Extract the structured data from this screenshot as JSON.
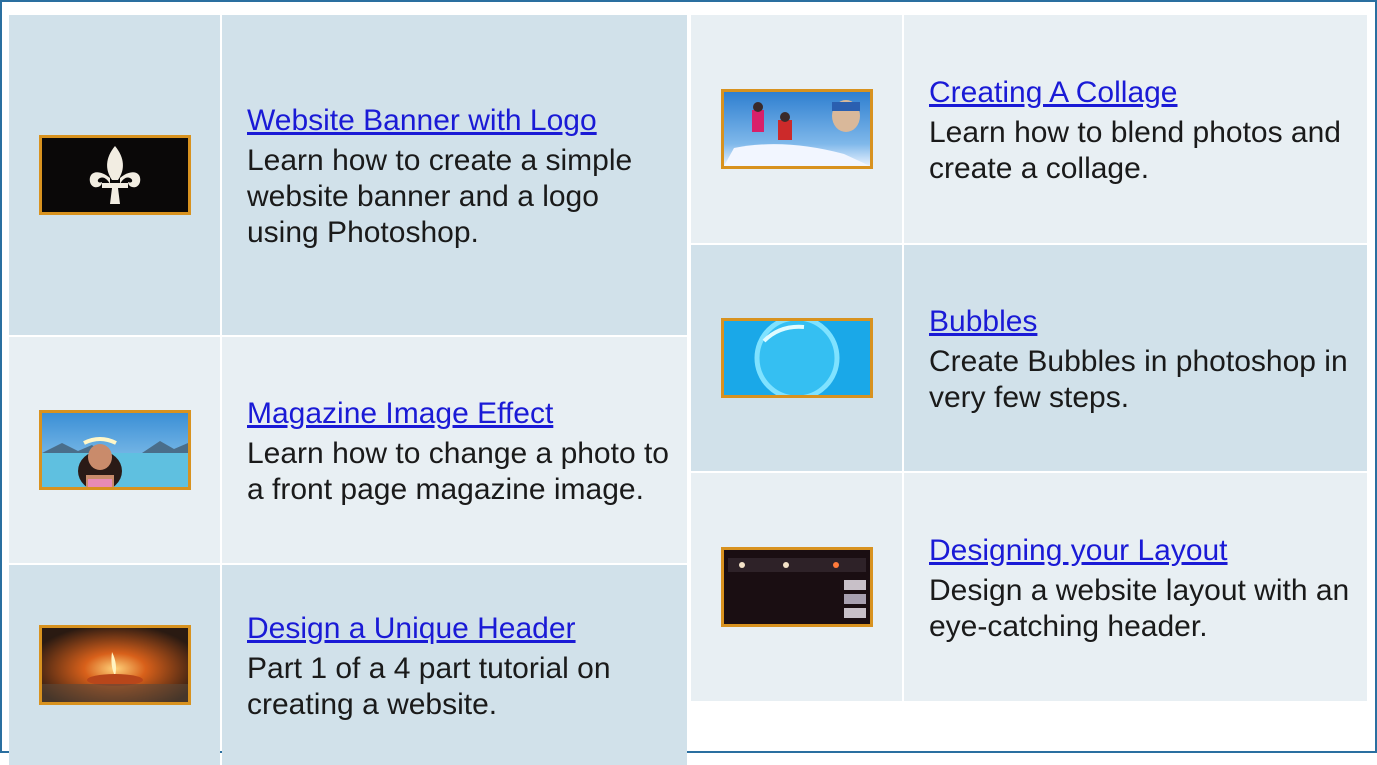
{
  "tutorials_left": [
    {
      "title": "Website Banner with Logo",
      "description": "Learn how to create a simple website banner and a logo using Photoshop.",
      "thumbnail": "fleur-de-lis-thumbnail"
    },
    {
      "title": "Magazine Image Effect",
      "description": "Learn how to change a photo to a front page magazine image.",
      "thumbnail": "beach-photo-thumbnail"
    },
    {
      "title": "Design a Unique Header",
      "description": "Part 1 of a 4 part tutorial on creating a website.",
      "thumbnail": "candle-thumbnail"
    }
  ],
  "tutorials_right": [
    {
      "title": "Creating A Collage",
      "description": "Learn how to blend photos and create a collage.",
      "thumbnail": "skiers-collage-thumbnail"
    },
    {
      "title": "Bubbles",
      "description": "Create Bubbles in photoshop in very few steps.",
      "thumbnail": "bubble-thumbnail"
    },
    {
      "title": "Designing your Layout",
      "description": "Design a website layout with an eye-catching header.",
      "thumbnail": "website-layout-thumbnail"
    }
  ],
  "colors": {
    "border": "#2a6fa0",
    "row_dark": "#d1e1ea",
    "row_light": "#e8eff3",
    "link": "#1a1ad6",
    "thumb_border": "#d8921f"
  }
}
